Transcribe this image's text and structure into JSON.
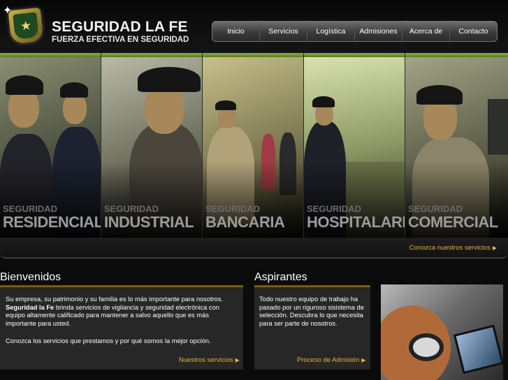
{
  "brand": {
    "title": "SEGURIDAD LA FE",
    "subtitle": "FUERZA EFECTIVA EN SEGURIDAD",
    "logo_icon": "shield-badge"
  },
  "nav": {
    "items": [
      {
        "label": "Inicio"
      },
      {
        "label": "Servicios"
      },
      {
        "label": "Logística"
      },
      {
        "label": "Admisiones"
      },
      {
        "label": "Acerca de"
      },
      {
        "label": "Contacto"
      }
    ]
  },
  "banner": {
    "panels": [
      {
        "line1": "SEGURIDAD",
        "line2": "RESIDENCIAL"
      },
      {
        "line1": "SEGURIDAD",
        "line2": "INDUSTRIAL"
      },
      {
        "line1": "SEGURIDAD",
        "line2": "BANCARIA"
      },
      {
        "line1": "SEGURIDAD",
        "line2": "HOSPITALARIA"
      },
      {
        "line1": "SEGURIDAD",
        "line2": "COMERCIAL"
      }
    ],
    "services_link": "Conozca nuestros servicios"
  },
  "welcome": {
    "title": "Bienvenidos",
    "para1": "Su empresa, su patrimonio y su familia es lo más importante para nosotros.",
    "para2_bold": "Seguridad la Fe",
    "para2_rest": " brinda servicios de vigilancia y seguridad electrónica con equipo altamente calificado para mantener a salvo aquello que es más importante para usted.",
    "para3": "Conozca los servicios que prestamos y por qué somos la mejor opción.",
    "link": "Nuestros servicios"
  },
  "applicants": {
    "title": "Aspirantes",
    "body": "Todo nuestro equipo de trabajo ha pasado por un riguroso sisistema de selección. Descubra lo que necesita para ser parte de nosotros.",
    "link": "Proceso de Admisión"
  },
  "colors": {
    "accent": "#e8b23c",
    "panel_green": "#8cb33a",
    "rule": "#7a5a14"
  }
}
